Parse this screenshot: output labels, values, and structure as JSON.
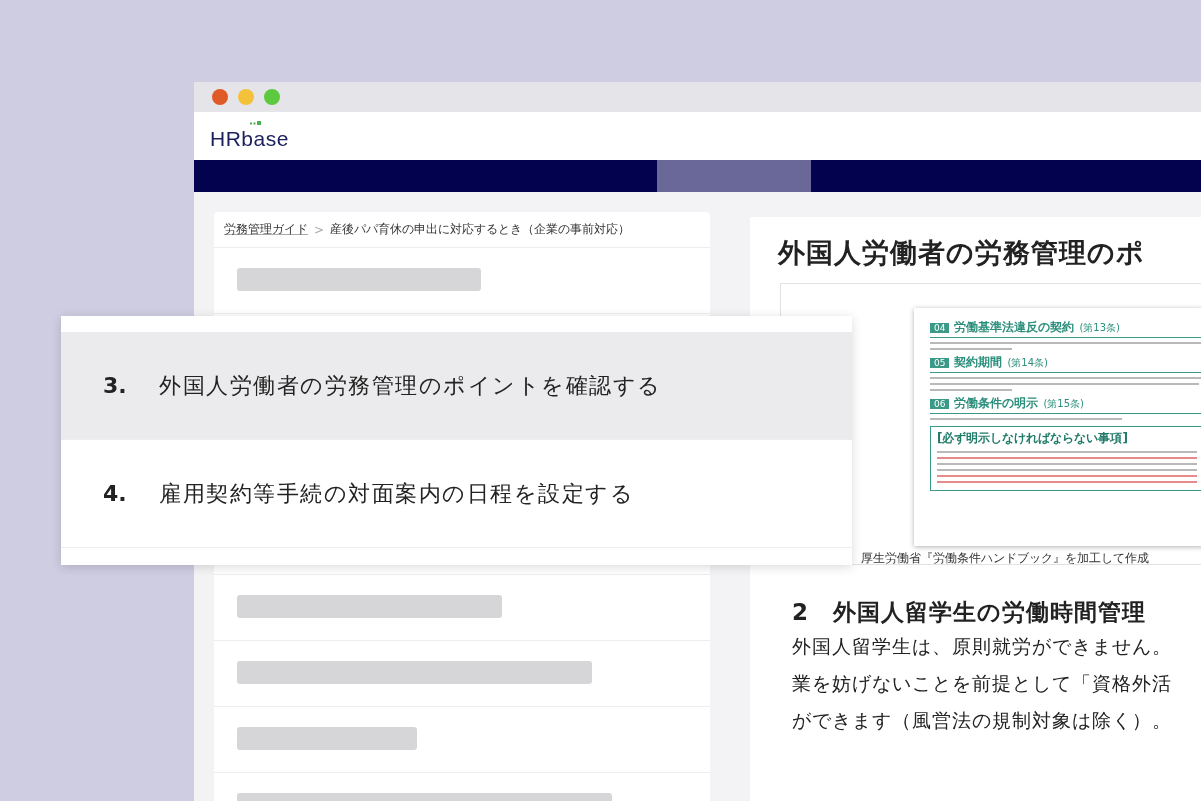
{
  "window": {
    "logo": "HRbase"
  },
  "breadcrumb": {
    "items": [
      "労務管理ガイド",
      "産後パパ育休の申出に対応するとき（企業の事前対応）"
    ],
    "separator": ">"
  },
  "article": {
    "title": "外国人労働者の労務管理のポ",
    "document": {
      "sections": [
        {
          "number": "04",
          "title": "労働基準法違反の契約",
          "article": "(第13条)"
        },
        {
          "number": "05",
          "title": "契約期間",
          "article": "(第14条)"
        },
        {
          "number": "06",
          "title": "労働条件の明示",
          "article": "(第15条)"
        }
      ],
      "box_title": "[必ず明示しなければならない事項]"
    },
    "caption": "厚生労働省『労働条件ハンドブック』を加工して作成",
    "heading": "2　外国人留学生の労働時間管理",
    "paragraph_lines": [
      "外国人留学生は、原則就労ができません。",
      "業を妨げないことを前提として「資格外活",
      "ができます（風営法の規制対象は除く）。"
    ]
  },
  "steps": [
    {
      "number": "3.",
      "text": "外国人労働者の労務管理のポイントを確認する",
      "selected": true
    },
    {
      "number": "4.",
      "text": "雇用契約等手続の対面案内の日程を設定する",
      "selected": false
    }
  ]
}
